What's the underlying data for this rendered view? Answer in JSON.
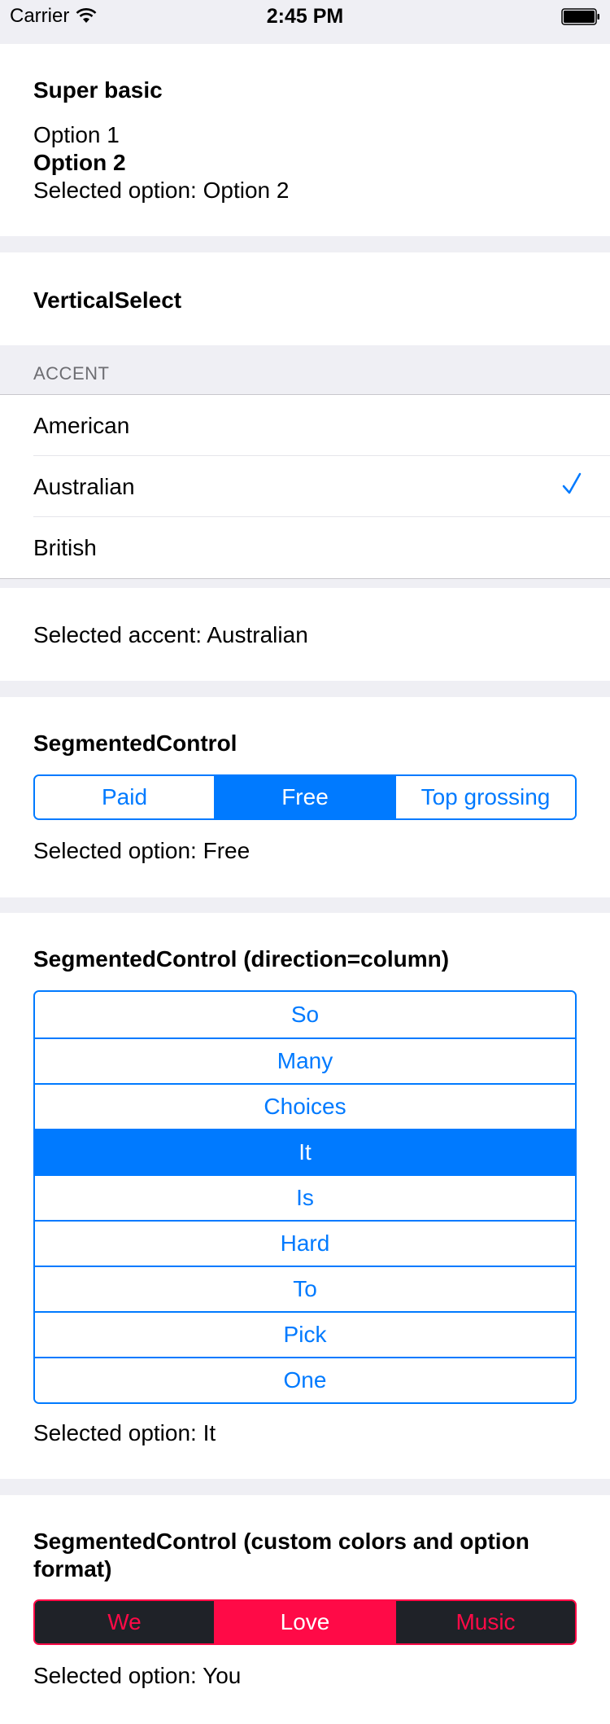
{
  "status_bar": {
    "carrier": "Carrier",
    "time": "2:45 PM"
  },
  "super_basic": {
    "title": "Super basic",
    "options": [
      "Option 1",
      "Option 2"
    ],
    "selected_text": "Selected option: Option 2"
  },
  "vertical_select": {
    "title": "VerticalSelect",
    "section_header": "ACCENT",
    "options": [
      "American",
      "Australian",
      "British"
    ],
    "selected_index": 1,
    "selected_text": "Selected accent: Australian"
  },
  "segmented": {
    "title": "SegmentedControl",
    "options": [
      "Paid",
      "Free",
      "Top grossing"
    ],
    "selected_index": 1,
    "selected_text": "Selected option: Free"
  },
  "segmented_column": {
    "title": "SegmentedControl (direction=column)",
    "options": [
      "So",
      "Many",
      "Choices",
      "It",
      "Is",
      "Hard",
      "To",
      "Pick",
      "One"
    ],
    "selected_index": 3,
    "selected_text": "Selected option: It"
  },
  "segmented_custom": {
    "title_line1": "SegmentedControl (custom colors and option",
    "title_line2": "format)",
    "options": [
      "We",
      "Love",
      "Music"
    ],
    "selected_index": 1,
    "selected_text": "Selected option: You"
  },
  "colors": {
    "accent": "#007aff",
    "custom_accent": "#ff0a47",
    "custom_bg": "#1f2228",
    "page_bg": "#efeff4"
  }
}
